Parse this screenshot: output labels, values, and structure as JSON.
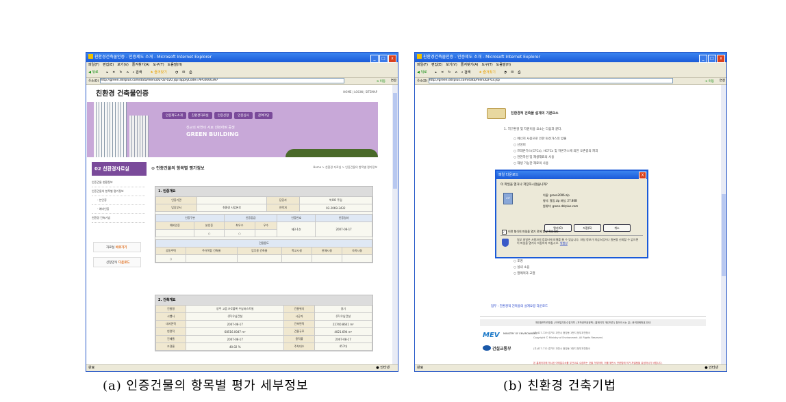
{
  "shared": {
    "window_title": "친환경건축물인증 - 인증제도 소개 - Microsoft Internet Explorer",
    "menu": [
      "파일(F)",
      "편집(E)",
      "보기(V)",
      "즐겨찾기(A)",
      "도구(T)",
      "도움말(H)"
    ],
    "toolbar": [
      "뒤로",
      "검색",
      "즐겨찾기"
    ],
    "addr_label": "주소(D)",
    "go_label": "이동",
    "links_label": "연결",
    "status_left": "완료",
    "status_right": "인터넷"
  },
  "winA": {
    "url": "http://green.ddrplus.com/data/menu02-02-020.jsp?applyCode=APL0000397",
    "site_title": "친환경 건축물인증",
    "toplinks": "HOME | LOGIN | SITEMAP",
    "nav": [
      "인증제도소개",
      "친환경자료실",
      "인증신청",
      "인증심사",
      "참여마당"
    ],
    "banner_line1": "친근의 자연이 서로 친화하며 공생",
    "banner_line2": "GREEN BUILDING",
    "sidebar_header": "02 친환경자료실",
    "sidebar_items": [
      {
        "label": "인증건물 현황정보",
        "sub": false
      },
      {
        "label": "인증건물의 항목별 평가정보",
        "sub": false
      },
      {
        "label": "- 본인증",
        "sub": true
      },
      {
        "label": "- 예비인증",
        "sub": true
      },
      {
        "label": "친환경 건축기법",
        "sub": false
      }
    ],
    "side_buttons": [
      {
        "pre": "자료실",
        "hl": "바로가기"
      },
      {
        "pre": "신청양식",
        "hl": "다운로드"
      }
    ],
    "page_title": "인증건물의 항목별 평가정보",
    "breadcrumb": "Home > 친환경 자료실 > 인증건물의 항목별 평가정보",
    "sec1": {
      "title": "1. 인증개요",
      "row1": [
        "인증기관",
        "",
        "담당자",
        "박OO 주임"
      ],
      "row2": [
        "담당부서",
        "친환경 사업본부",
        "연락처",
        "02-2069-3432"
      ],
      "hdrs": [
        "인증구분",
        "인증등급",
        "인증번호",
        "인증일자"
      ],
      "subhdrs": [
        "예비인증",
        "본인증",
        "최우수",
        "우수"
      ],
      "marks": [
        "",
        "○",
        "○",
        ""
      ],
      "cert_no": "제3-1호",
      "cert_date": "2007-08-17",
      "usage_title": "건물용도",
      "usages": [
        "공동주택",
        "주거복합 건축물",
        "업무용 건축물",
        "학교시설",
        "판매시설",
        "숙박시설"
      ],
      "usage_marks": [
        "○",
        "",
        "",
        "",
        "",
        ""
      ]
    },
    "sec2": {
      "title": "2. 건축개요",
      "rows": [
        [
          "건물명",
          "양주 고읍 A-2블록 우남퍼스트빌",
          "건물위치",
          "경기"
        ],
        [
          "시행사",
          "(주)우남건설",
          "시공자",
          "(주)우남건설"
        ],
        [
          "대지면적",
          "2007-08-17",
          "건축면적",
          "22740.8641 m²"
        ],
        [
          "연면적",
          "68516.0047 m²",
          "건물규모",
          "4021.694 m²"
        ],
        [
          "건폐율",
          "2007-08-17",
          "용적률",
          "2007-08-17"
        ],
        [
          "조경율",
          "40.02 %",
          "주차대수",
          "457대"
        ]
      ]
    }
  },
  "winB": {
    "url": "http://green.ddrplus.com/data/menu02-03.jsp",
    "section_header": "친환경적 건축물 설계의 기본요소",
    "item1": "1.  지구환경 및 자원이용 요소는 다음과 같다.",
    "list_top": [
      "에너지 사용으로 인한 탄산가스의 방출",
      "산성비",
      "프레온가스(CFCs), HCFCs 및 하론가스에 의한 오존층의 파괴",
      "천연자원 및 재생재료의 사용",
      "재생 가능한 재료의 사용"
    ],
    "dialog": {
      "title": "파일 다운로드",
      "close": "X",
      "question": "이 파일을 열거나 저장하시겠습니까?",
      "file_icon": "ZIP",
      "name": "이름:  green2006.zip",
      "type": "형식:  알집 zip 파일, 27.8KB",
      "from": "원위치:  green.ddrplus.com",
      "buttons": [
        "열기(O)",
        "저장(S)",
        "취소"
      ],
      "checkbox": "이런 형식의 파일을 열기 전에 항상 확인(W)",
      "warning": "일부 파일은 사용자의 컴퓨터에 피해를 줄 수 있습니다. 파일 정보가 의심스럽거나 원본을 신뢰할 수 없으면 이 파일을 열거나 저장하지 마십시오.",
      "risk_link": "위험성"
    },
    "list_bottom": [
      "조명",
      "실내 소음",
      "열쾌적과 교열"
    ],
    "link": "첨부 : 친환경적 건축물의 설계요령 다운로드",
    "footer_links": "개인정보처리방침 | 이메일무단수집거부 | 저작권보호정책 | 홈페이지 개선의견 | 찾아오시는 길 | 문의전화번호 안내",
    "mev": "MEV",
    "mev_sub": "MINISTRY OF ENVIRONMENT",
    "moct": "건설교통부",
    "addr1": "(우)427-729 경기도 과천시 중앙동 1번지 정부과천청사",
    "addr2": "Copyright © Ministry of Environment. All Rights Reserved.",
    "addr3": "(우)427-712 경기도 과천시 중앙동 1번지 정부과천청사",
    "red_note": "본 홈페이지에 게시된 이메일주소를 무단으로 수집하는 것을 거부하며, 이를 위반시 관련법에 의거 처벌됨을 유념하시기 바랍니다."
  },
  "captions": [
    "(a) 인증건물의 항목별 평가 세부정보",
    "(b) 친환경 건축기법"
  ]
}
